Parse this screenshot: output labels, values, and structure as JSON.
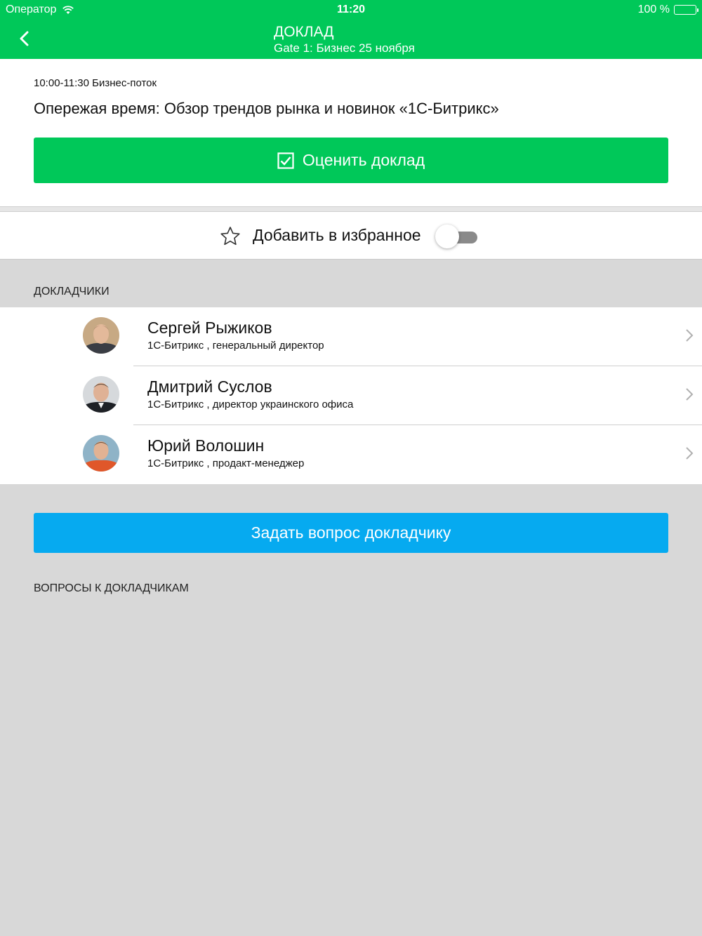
{
  "status_bar": {
    "carrier": "Оператор",
    "time": "11:20",
    "battery": "100 %"
  },
  "nav": {
    "title": "ДОКЛАД",
    "subtitle": "Gate 1: Бизнес 25 ноября"
  },
  "talk": {
    "time": "10:00-11:30 Бизнес-поток",
    "title": "Опережая время: Обзор трендов рынка и новинок «1С-Битрикс»",
    "rate_label": "Оценить доклад"
  },
  "favorite": {
    "label": "Добавить в избранное",
    "enabled": false
  },
  "speakers": {
    "header": "ДОКЛАДЧИКИ",
    "items": [
      {
        "name": "Сергей Рыжиков",
        "role": "1С-Битрикс , генеральный директор"
      },
      {
        "name": "Дмитрий Суслов",
        "role": "1С-Битрикс , директор украинского офиса"
      },
      {
        "name": "Юрий Волошин",
        "role": "1С-Битрикс , продакт-менеджер"
      }
    ]
  },
  "ask_button": "Задать вопрос докладчику",
  "questions_header": "ВОПРОСЫ К ДОКЛАДЧИКАМ",
  "colors": {
    "brand_green": "#00c859",
    "ask_blue": "#06aaf0",
    "background": "#d8d8d8"
  },
  "icons": [
    "wifi-icon",
    "battery-icon",
    "back-chevron-icon",
    "checkbox-icon",
    "star-icon",
    "chevron-right-icon"
  ]
}
